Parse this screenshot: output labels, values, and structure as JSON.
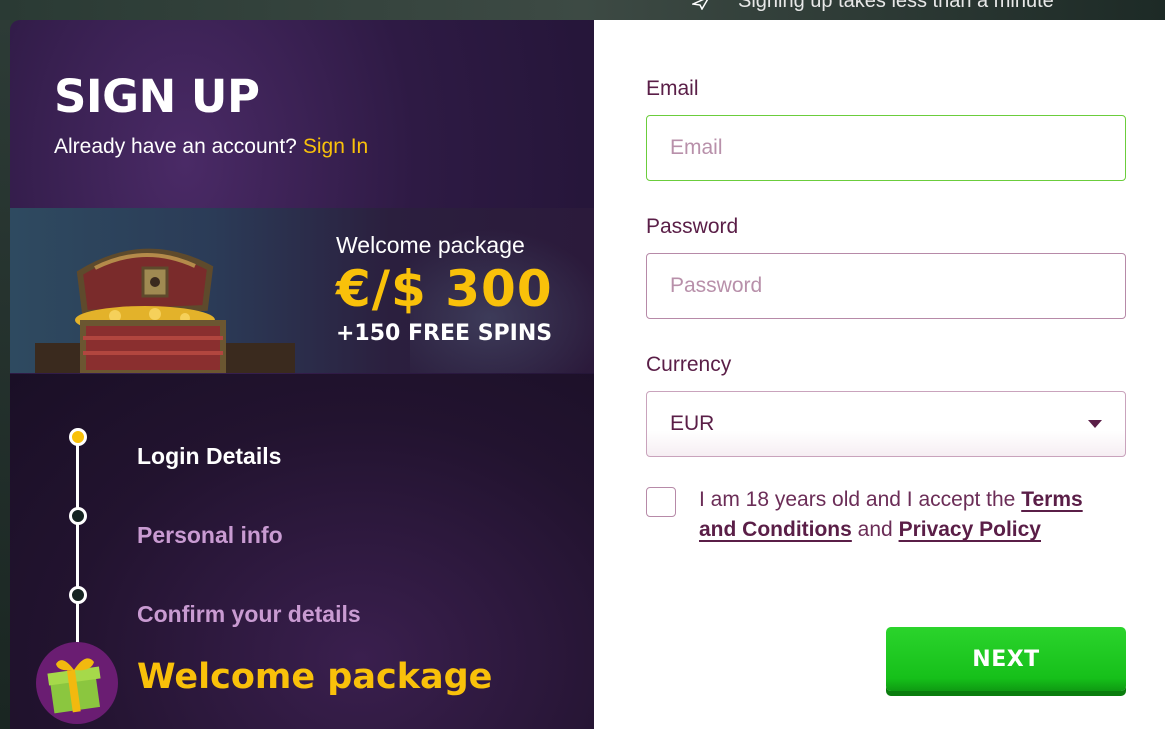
{
  "background": {
    "tagline": "Signing up takes less than a minute"
  },
  "signup": {
    "title": "SIGN UP",
    "account_prompt": "Already have an account?",
    "signin_link": "Sign In"
  },
  "promo": {
    "label": "Welcome package",
    "amount": "€/$ 300",
    "spins": "+150 FREE SPINS"
  },
  "steps": {
    "items": [
      {
        "label": "Login Details",
        "state": "active"
      },
      {
        "label": "Personal info",
        "state": "inactive"
      },
      {
        "label": "Confirm your details",
        "state": "inactive"
      }
    ],
    "final_label": "Welcome package"
  },
  "form": {
    "email": {
      "label": "Email",
      "placeholder": "Email",
      "value": ""
    },
    "password": {
      "label": "Password",
      "placeholder": "Password",
      "value": ""
    },
    "currency": {
      "label": "Currency",
      "selected": "EUR"
    },
    "terms": {
      "prefix": "I am 18 years old and I accept the",
      "terms_link": "Terms and Conditions",
      "and": "and",
      "privacy_link": "Privacy Policy",
      "checked": false
    },
    "next_label": "NEXT"
  },
  "colors": {
    "accent_yellow": "#f9c10a",
    "next_green": "#16c01a",
    "label_purple": "#5a1e47",
    "focus_green": "#6bcd3c"
  }
}
